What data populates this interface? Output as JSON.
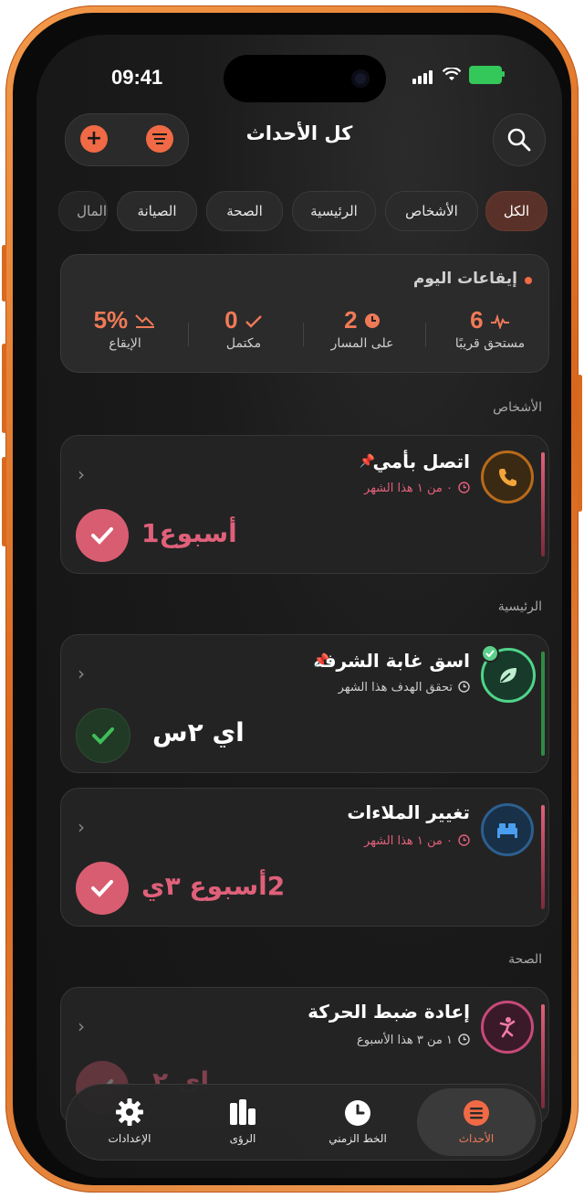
{
  "status": {
    "time": "09:41"
  },
  "header": {
    "title": "كل الأحداث"
  },
  "filters": [
    "الكل",
    "الأشخاص",
    "الرئيسية",
    "الصحة",
    "الصيانة",
    "المال"
  ],
  "rhythm": {
    "title": "إيقاعات اليوم",
    "stats": [
      {
        "value": "6",
        "label": "مستحق قريبًا"
      },
      {
        "value": "2",
        "label": "على المسار"
      },
      {
        "value": "0",
        "label": "مكتمل"
      },
      {
        "value": "5%",
        "label": "الإيقاع"
      }
    ]
  },
  "sections": {
    "people": "الأشخاص",
    "home": "الرئيسية",
    "health": "الصحة"
  },
  "cards": [
    {
      "title": "اتصل بأمي",
      "sub": "٠ من ١ هذا الشهر",
      "big": "أسبوع1",
      "accent": "#e0607a"
    },
    {
      "title": "اسق غابة الشرفة",
      "sub": "تحقق الهدف هذا الشهر",
      "big": "اي ٢س",
      "accent": "#3fbf5a"
    },
    {
      "title": "تغيير الملاءات",
      "sub": "٠ من ١ هذا الشهر",
      "big": "2أسبوع ٣ي",
      "accent": "#e0607a"
    },
    {
      "title": "إعادة ضبط الحركة",
      "sub": "١ من ٣ هذا الأسبوع",
      "big": "اي ٢",
      "accent": "#e0607a"
    }
  ],
  "tabs": [
    {
      "label": "الأحداث"
    },
    {
      "label": "الخط الزمني"
    },
    {
      "label": "الرؤى"
    },
    {
      "label": "الإعدادات"
    }
  ]
}
